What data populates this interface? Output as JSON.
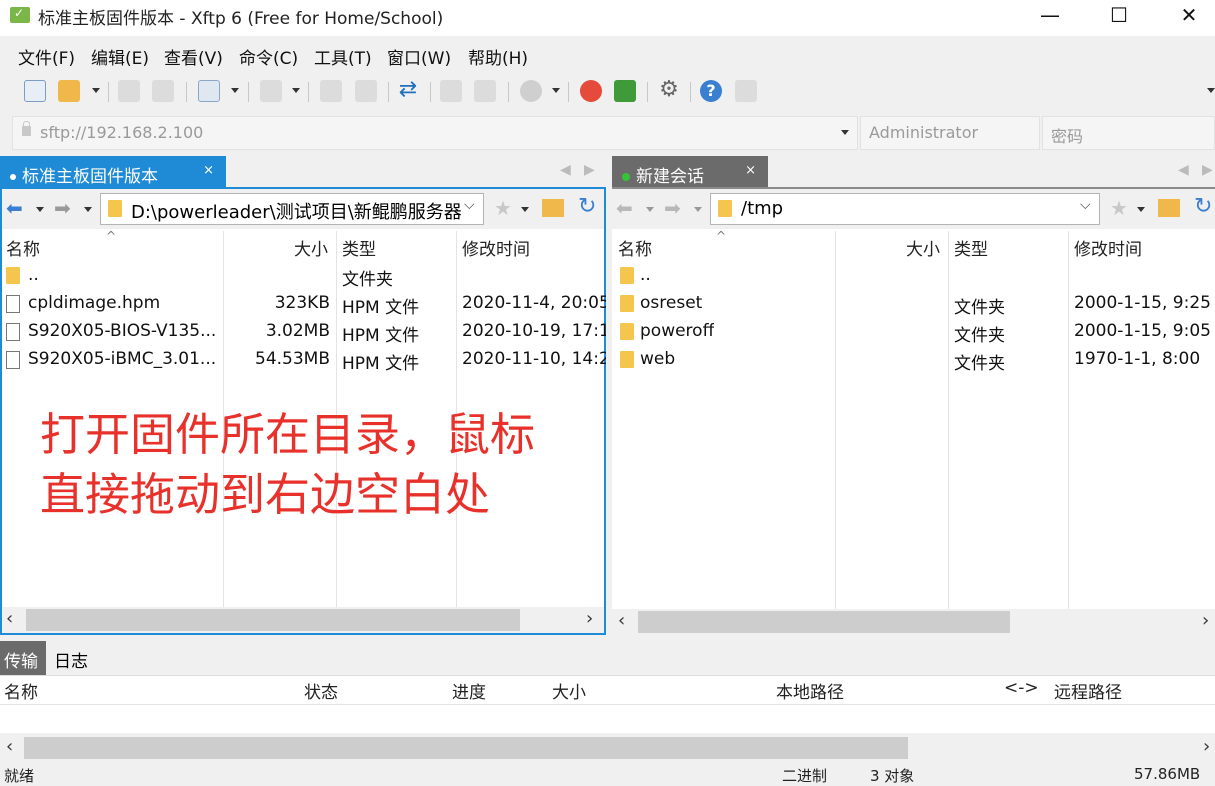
{
  "window": {
    "title": "标准主板固件版本 - Xftp 6 (Free for Home/School)",
    "minimize": "—",
    "maximize": "☐",
    "close": "✕"
  },
  "menu": [
    "文件(F)",
    "编辑(E)",
    "查看(V)",
    "命令(C)",
    "工具(T)",
    "窗口(W)",
    "帮助(H)"
  ],
  "address": {
    "url": "sftp://192.168.2.100",
    "user_placeholder": "Administrator",
    "password_placeholder": "密码"
  },
  "left": {
    "tab_label": "标准主板固件版本",
    "tab_close": "×",
    "path": "D:\\powerleader\\测试项目\\新鲲鹏服务器",
    "columns": [
      "名称",
      "大小",
      "类型",
      "修改时间"
    ],
    "rows": [
      {
        "name": "..",
        "size": "",
        "type": "文件夹",
        "modified": "",
        "icon": "folder-icon"
      },
      {
        "name": "cpldimage.hpm",
        "size": "323KB",
        "type": "HPM 文件",
        "modified": "2020-11-4, 20:05",
        "icon": "file-icon"
      },
      {
        "name": "S920X05-BIOS-V135...",
        "size": "3.02MB",
        "type": "HPM 文件",
        "modified": "2020-10-19, 17:1",
        "icon": "file-icon"
      },
      {
        "name": "S920X05-iBMC_3.01...",
        "size": "54.53MB",
        "type": "HPM 文件",
        "modified": "2020-11-10, 14:2",
        "icon": "file-icon"
      }
    ]
  },
  "right": {
    "tab_label": "新建会话",
    "tab_close": "×",
    "path": "/tmp",
    "columns": [
      "名称",
      "大小",
      "类型",
      "修改时间"
    ],
    "rows": [
      {
        "name": "..",
        "size": "",
        "type": "",
        "modified": "",
        "icon": "folder-icon"
      },
      {
        "name": "osreset",
        "size": "",
        "type": "文件夹",
        "modified": "2000-1-15, 9:25",
        "icon": "folder-icon"
      },
      {
        "name": "poweroff",
        "size": "",
        "type": "文件夹",
        "modified": "2000-1-15, 9:05",
        "icon": "folder-icon"
      },
      {
        "name": "web",
        "size": "",
        "type": "文件夹",
        "modified": "1970-1-1, 8:00",
        "icon": "folder-icon"
      }
    ]
  },
  "annotation": {
    "line1": "打开固件所在目录，鼠标",
    "line2": "直接拖动到右边空白处"
  },
  "transfer": {
    "tabs": [
      "传输",
      "日志"
    ],
    "columns": [
      "名称",
      "状态",
      "进度",
      "大小",
      "本地路径",
      "<->",
      "远程路径"
    ]
  },
  "statusbar": {
    "left": "就绪",
    "mode": "二进制",
    "objects": "3 对象",
    "size": "57.86MB"
  },
  "colors": {
    "active_tab": "#1f8ad6",
    "inactive_tab": "#6b6b6b",
    "annotation": "#e8312a",
    "connected_dot": "#37c337"
  }
}
